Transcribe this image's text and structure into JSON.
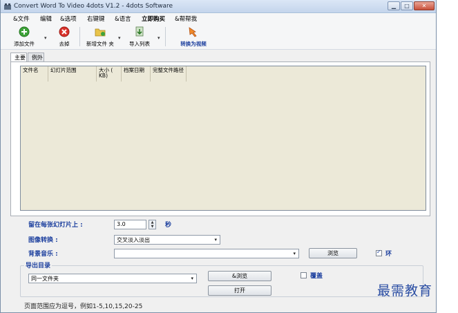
{
  "window": {
    "title": "Convert Word To Video 4dots V1.2 - 4dots Software"
  },
  "menu": [
    {
      "label": "&文件",
      "bold": false
    },
    {
      "label": "编辑",
      "bold": false
    },
    {
      "label": "&选项",
      "bold": false
    },
    {
      "label": "右键键",
      "bold": false
    },
    {
      "label": "&语言",
      "bold": false
    },
    {
      "label": "立即购买",
      "bold": true
    },
    {
      "label": "&帮帮我",
      "bold": false
    }
  ],
  "toolbar": {
    "add_file": "添加文件",
    "remove": "去掉",
    "new_folder": "新增文件 夹",
    "import_list": "导入列表",
    "convert": "转换为视频"
  },
  "tabs": [
    {
      "label": "主要",
      "active": true
    },
    {
      "label": "例外",
      "active": false
    }
  ],
  "listview": {
    "columns": [
      "文件名",
      "幻灯片范围",
      "大小 ( KB)",
      "档案日期",
      "完整文件路径"
    ]
  },
  "settings": {
    "per_slide_label": "留在每张幻灯片上 :",
    "per_slide_value": "3.0",
    "per_slide_unit": "秒",
    "transition_label": "图像转换 :",
    "transition_value": "交叉淡入淡出",
    "music_label": "背景音乐 :",
    "music_value": "",
    "browse_music": "浏览",
    "loop_label": "环",
    "loop_checked": true
  },
  "output": {
    "group_label": "导出目录",
    "folder_value": "同一文件夹",
    "browse": "&浏览",
    "open": "打开",
    "overwrite_label": "覆盖",
    "overwrite_checked": false
  },
  "status": {
    "hint": "页面范围应为逗号，例如1-5,10,15,20-25"
  },
  "watermark": "最需教育",
  "colors": {
    "accent_blue": "#1c3f9e",
    "list_bg": "#ece9d8",
    "window_bg": "#f0f0f0"
  }
}
